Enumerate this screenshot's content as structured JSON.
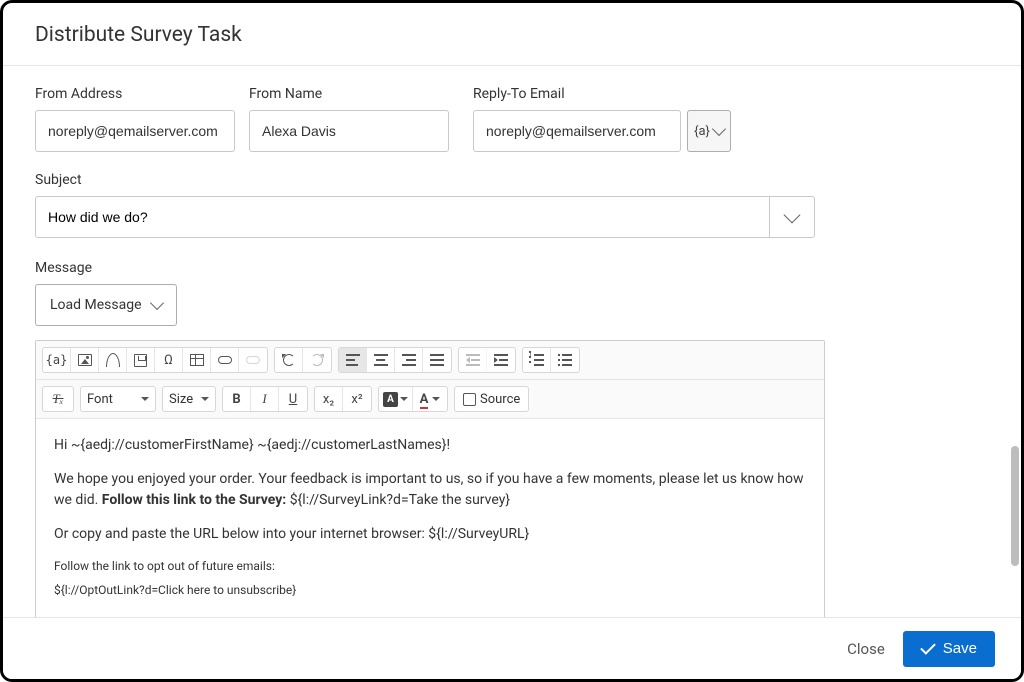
{
  "title": "Distribute Survey Task",
  "labels": {
    "from_address": "From Address",
    "from_name": "From Name",
    "reply_to": "Reply-To Email",
    "subject": "Subject",
    "message": "Message"
  },
  "values": {
    "from_address": "noreply@qemailserver.com",
    "from_name": "Alexa Davis",
    "reply_to": "noreply@qemailserver.com",
    "subject": "How did we do?"
  },
  "token_btn": "{a}",
  "load_message": "Load Message",
  "toolbar": {
    "token": "{a}",
    "omega": "Ω",
    "font_label": "Font",
    "size_label": "Size",
    "bold": "B",
    "italic": "I",
    "underline": "U",
    "sub": "x₂",
    "sup": "x²",
    "A": "A",
    "source": "Source",
    "Tx": "Tₓ"
  },
  "message_body": {
    "greeting": "Hi ~{aedj://customerFirstName} ~{aedj://customerLastNames}!",
    "line2a": "We hope you enjoyed your order. Your feedback is important to us, so if you have a few moments, please let us know how we did.  ",
    "line2_bold": "Follow this link to the Survey:",
    "line2_link": " ${l://SurveyLink?d=Take the survey}",
    "line3": "Or copy and paste the URL below into your internet browser: ${l://SurveyURL}",
    "opt_label": "Follow the link to opt out of future emails:",
    "opt_link": "${l://OptOutLink?d=Click here to unsubscribe}"
  },
  "footer": {
    "close": "Close",
    "save": "Save"
  }
}
